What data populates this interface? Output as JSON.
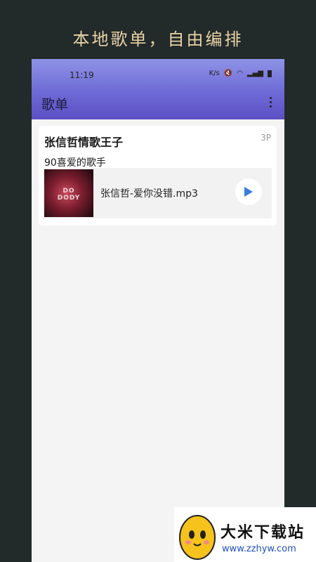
{
  "promo": {
    "title": "本地歌单，自由编排"
  },
  "status_bar": {
    "time": "11:19",
    "icons": [
      "speed-icon",
      "mute-icon",
      "wifi-icon",
      "signal-icon",
      "battery-icon"
    ]
  },
  "appbar": {
    "title": "歌单",
    "menu_icon": "more-vert-icon"
  },
  "playlist": {
    "title": "张信哲情歌王子",
    "count": "3P",
    "description": "90喜爱的歌手",
    "tracks": [
      {
        "name": "张信哲-爱你没错.mp3",
        "cover_text": "DO DODY",
        "play_icon": "play-icon"
      }
    ]
  },
  "colors": {
    "accent": "#3a7be0",
    "appbar_top": "#8e93e6",
    "appbar_bottom": "#5c4fc4",
    "promo_text": "#e9d3a6"
  },
  "watermark": {
    "title": "大米下载站",
    "url": "www.zzhyw.com"
  }
}
